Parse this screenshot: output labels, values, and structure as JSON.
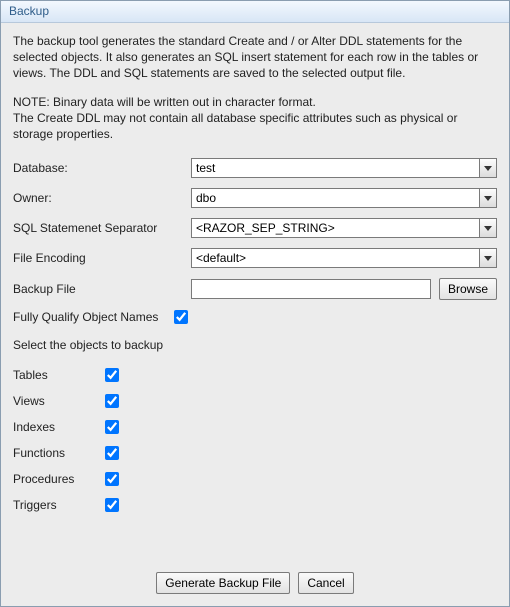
{
  "title": "Backup",
  "description": "The backup tool generates the standard Create and / or Alter DDL statements for the selected objects. It also generates an SQL insert statement for each row in the tables or views. The DDL and SQL statements are saved to the selected output file.",
  "note": "NOTE: Binary data will be written out in character format.\nThe Create DDL may not contain all database specific attributes such as physical or storage properties.",
  "fields": {
    "database": {
      "label": "Database:",
      "value": "test"
    },
    "owner": {
      "label": "Owner:",
      "value": "dbo"
    },
    "separator": {
      "label": "SQL Statemenet Separator",
      "value": "<RAZOR_SEP_STRING>"
    },
    "encoding": {
      "label": "File Encoding",
      "value": "<default>"
    },
    "backup_file": {
      "label": "Backup File",
      "value": ""
    },
    "browse_label": "Browse",
    "fully_qualify": {
      "label": "Fully Qualify Object Names",
      "checked": true
    }
  },
  "objects_heading": "Select the objects to backup",
  "objects": {
    "tables": {
      "label": "Tables",
      "checked": true
    },
    "views": {
      "label": "Views",
      "checked": true
    },
    "indexes": {
      "label": "Indexes",
      "checked": true
    },
    "functions": {
      "label": "Functions",
      "checked": true
    },
    "procedures": {
      "label": "Procedures",
      "checked": true
    },
    "triggers": {
      "label": "Triggers",
      "checked": true
    }
  },
  "buttons": {
    "generate": "Generate Backup File",
    "cancel": "Cancel"
  }
}
